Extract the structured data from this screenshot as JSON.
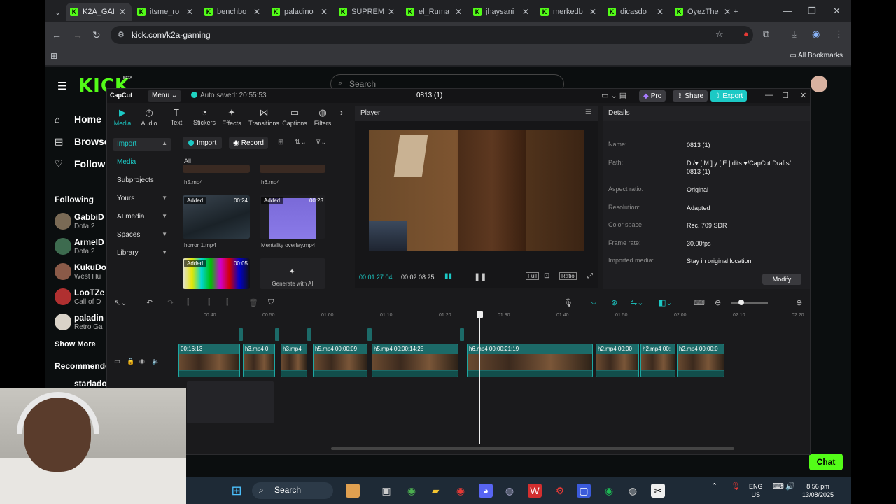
{
  "browser": {
    "tabs": [
      {
        "label": "K2A_GAI",
        "active": true
      },
      {
        "label": "itsme_ro",
        "active": false
      },
      {
        "label": "benchbo",
        "active": false
      },
      {
        "label": "paladino",
        "active": false
      },
      {
        "label": "SUPREM",
        "active": false
      },
      {
        "label": "el_Ruma",
        "active": false
      },
      {
        "label": "jhaysani",
        "active": false
      },
      {
        "label": "merkedb",
        "active": false
      },
      {
        "label": "dicasdo",
        "active": false
      },
      {
        "label": "OyezThe",
        "active": false
      }
    ],
    "url": "kick.com/k2a-gaming",
    "all_bookmarks": "All Bookmarks"
  },
  "kick": {
    "logo": "KICK",
    "beta": "BETA",
    "search_placeholder": "Search",
    "nav": {
      "home": "Home",
      "browse": "Browse",
      "following": "Following"
    },
    "following_header": "Following",
    "following": [
      {
        "name": "GabbiD",
        "game": "Dota 2"
      },
      {
        "name": "ArmelD",
        "game": "Dota 2"
      },
      {
        "name": "KukuDo",
        "game": "West Hu"
      },
      {
        "name": "LooTZe",
        "game": "Call of D"
      },
      {
        "name": "paladin",
        "game": "Retro Ga"
      }
    ],
    "show_more": "Show More",
    "recommended": "Recommende",
    "starlado": "starlado",
    "chat": "Chat"
  },
  "capcut": {
    "logo": "CapCut",
    "menu": "Menu",
    "autosaved": "Auto saved: 20:55:53",
    "project_title": "0813 (1)",
    "pro": "Pro",
    "share": "Share",
    "export": "Export",
    "tools": [
      {
        "label": "Media",
        "icon": "media-icon",
        "glyph": "▶"
      },
      {
        "label": "Audio",
        "icon": "audio-icon",
        "glyph": "◷"
      },
      {
        "label": "Text",
        "icon": "text-icon",
        "glyph": "T"
      },
      {
        "label": "Stickers",
        "icon": "stickers-icon",
        "glyph": "◔"
      },
      {
        "label": "Effects",
        "icon": "effects-icon",
        "glyph": "✦"
      },
      {
        "label": "Transitions",
        "icon": "transitions-icon",
        "glyph": "⋈"
      },
      {
        "label": "Captions",
        "icon": "captions-icon",
        "glyph": "▭"
      },
      {
        "label": "Filters",
        "icon": "filters-icon",
        "glyph": "◍"
      }
    ],
    "left_nav": {
      "import": "Import",
      "media": "Media",
      "subprojects": "Subprojects",
      "yours": "Yours",
      "ai_media": "AI media",
      "spaces": "Spaces",
      "library": "Library"
    },
    "media_toolbar": {
      "import": "Import",
      "record": "Record",
      "all": "All"
    },
    "media_items": [
      {
        "name": "h5.mp4",
        "added": "",
        "duration": ""
      },
      {
        "name": "h6.mp4",
        "added": "",
        "duration": ""
      },
      {
        "name": "horror 1.mp4",
        "added": "Added",
        "duration": "00:24"
      },
      {
        "name": "Mentality overlay.mp4",
        "added": "Added",
        "duration": "00:23"
      },
      {
        "name": "",
        "added": "Added",
        "duration": "00:05"
      }
    ],
    "generate_ai": "Generate with AI",
    "player": {
      "header": "Player",
      "current_time": "00:01:27:04",
      "total_time": "00:02:08:25",
      "full": "Full",
      "ratio": "Ratio"
    },
    "details": {
      "header": "Details",
      "rows": [
        {
          "key": "Name:",
          "value": "0813 (1)"
        },
        {
          "key": "Path:",
          "value": "D:/♥ [ M ] y [ E ] dits ♥/CapCut Drafts/ 0813 (1)"
        },
        {
          "key": "Aspect ratio:",
          "value": "Original"
        },
        {
          "key": "Resolution:",
          "value": "Adapted"
        },
        {
          "key": "Color space",
          "value": "Rec. 709 SDR"
        },
        {
          "key": "Frame rate:",
          "value": "30.00fps"
        },
        {
          "key": "Imported media:",
          "value": "Stay in original location"
        }
      ],
      "modify": "Modify"
    },
    "ruler": [
      "00:40",
      "00:50",
      "01:00",
      "01:10",
      "01:20",
      "01:30",
      "01:40",
      "01:50",
      "02:00",
      "02:10",
      "02:20"
    ],
    "clips": [
      {
        "label": "00:16:13"
      },
      {
        "label": "h3.mp4  0"
      },
      {
        "label": "h3.mp4"
      },
      {
        "label": "h5.mp4  00:00:09"
      },
      {
        "label": "h5.mp4  00:00:14:25"
      },
      {
        "label": "h6.mp4  00:00:21:19"
      },
      {
        "label": "h2.mp4  00:00"
      },
      {
        "label": "h2.mp4  00:"
      },
      {
        "label": "h2.mp4  00:00:0"
      }
    ]
  },
  "taskbar": {
    "search": "Search",
    "lang1": "ENG",
    "lang2": "US",
    "time": "8:56 pm",
    "date": "13/08/2025"
  },
  "colors": {
    "kick_green": "#53fc18",
    "capcut_teal": "#1cc9c5",
    "clip_teal": "#1c6a68"
  }
}
